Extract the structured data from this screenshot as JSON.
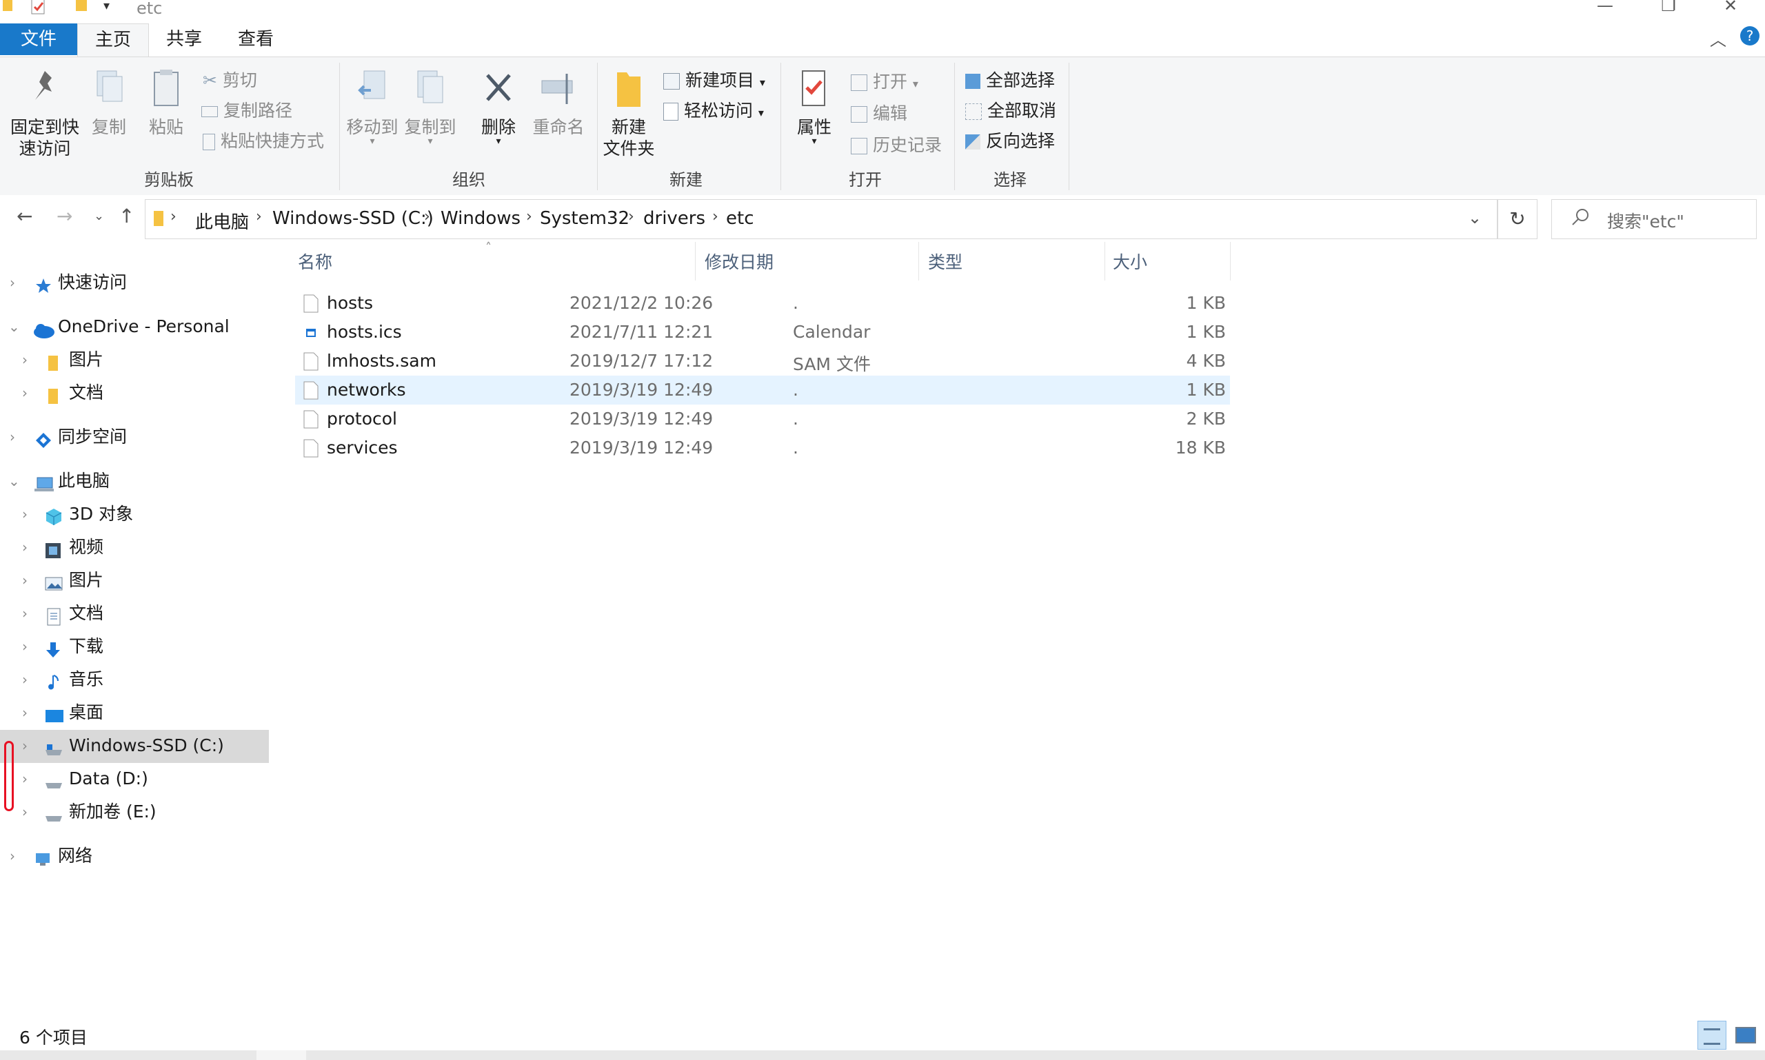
{
  "window": {
    "title": "etc",
    "controls": {
      "minimize": "—",
      "maximize": "❐",
      "close": "✕"
    }
  },
  "ribbon_tabs": [
    {
      "label": "文件"
    },
    {
      "label": "主页"
    },
    {
      "label": "共享"
    },
    {
      "label": "查看"
    }
  ],
  "ribbon": {
    "clipboard": {
      "pin_label_1": "固定到快",
      "pin_label_2": "速访问",
      "copy_label": "复制",
      "paste_label": "粘贴",
      "cut_label": "剪切",
      "copy_path_label": "复制路径",
      "paste_shortcut_label": "粘贴快捷方式",
      "group_label": "剪贴板"
    },
    "organize": {
      "move_to_label": "移动到",
      "copy_to_label": "复制到",
      "delete_label": "删除",
      "rename_label": "重命名",
      "group_label": "组织"
    },
    "new": {
      "new_folder_label_1": "新建",
      "new_folder_label_2": "文件夹",
      "new_item_label": "新建项目",
      "easy_access_label": "轻松访问",
      "group_label": "新建"
    },
    "open": {
      "properties_label": "属性",
      "open_label": "打开",
      "edit_label": "编辑",
      "history_label": "历史记录",
      "group_label": "打开"
    },
    "select": {
      "select_all_label": "全部选择",
      "select_none_label": "全部取消",
      "invert_label": "反向选择",
      "group_label": "选择"
    }
  },
  "address": {
    "breadcrumb": [
      "此电脑",
      "Windows-SSD (C:)",
      "Windows",
      "System32",
      "drivers",
      "etc"
    ],
    "search_placeholder": "搜索\"etc\""
  },
  "nav_pane": {
    "items": [
      {
        "label": "快速访问",
        "icon": "star-icon"
      },
      {
        "label": "OneDrive - Personal",
        "icon": "cloud-icon"
      },
      {
        "label": "图片",
        "icon": "folder-icon"
      },
      {
        "label": "文档",
        "icon": "folder-icon"
      },
      {
        "label": "同步空间",
        "icon": "sync-icon"
      },
      {
        "label": "此电脑",
        "icon": "computer-icon"
      },
      {
        "label": "3D 对象",
        "icon": "cube-icon"
      },
      {
        "label": "视频",
        "icon": "video-icon"
      },
      {
        "label": "图片",
        "icon": "picture-icon"
      },
      {
        "label": "文档",
        "icon": "document-icon"
      },
      {
        "label": "下载",
        "icon": "download-icon"
      },
      {
        "label": "音乐",
        "icon": "music-icon"
      },
      {
        "label": "桌面",
        "icon": "desktop-icon"
      },
      {
        "label": "Windows-SSD (C:)",
        "icon": "drive-icon"
      },
      {
        "label": "Data (D:)",
        "icon": "drive-icon"
      },
      {
        "label": "新加卷 (E:)",
        "icon": "drive-icon"
      },
      {
        "label": "网络",
        "icon": "network-icon"
      }
    ]
  },
  "file_list": {
    "columns": {
      "name": "名称",
      "date": "修改日期",
      "type": "类型",
      "size": "大小"
    },
    "rows": [
      {
        "name": "hosts",
        "date": "2021/12/2 10:26",
        "type": ".",
        "size": "1 KB"
      },
      {
        "name": "hosts.ics",
        "date": "2021/7/11 12:21",
        "type": "Calendar",
        "size": "1 KB"
      },
      {
        "name": "lmhosts.sam",
        "date": "2019/12/7 17:12",
        "type": "SAM 文件",
        "size": "4 KB"
      },
      {
        "name": "networks",
        "date": "2019/3/19 12:49",
        "type": ".",
        "size": "1 KB"
      },
      {
        "name": "protocol",
        "date": "2019/3/19 12:49",
        "type": ".",
        "size": "2 KB"
      },
      {
        "name": "services",
        "date": "2019/3/19 12:49",
        "type": ".",
        "size": "18 KB"
      }
    ],
    "selected_row": "networks"
  },
  "status": {
    "count": "6 个项目"
  },
  "colors": {
    "accent": "#1979ca",
    "selection": "#e5f3ff",
    "nav_selected": "#d9d9d9"
  }
}
